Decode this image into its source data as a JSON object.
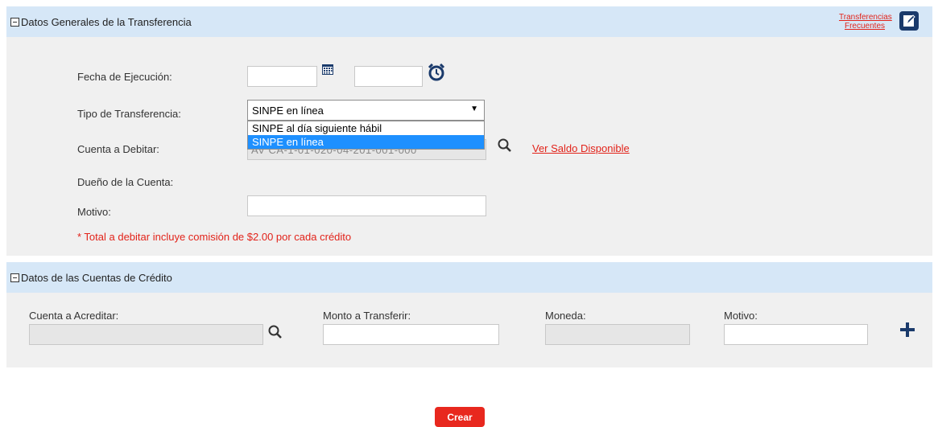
{
  "general": {
    "title": "Datos Generales de la Transferencia",
    "frequent_link_line1": "Transferencias",
    "frequent_link_line2": "Frecuentes",
    "fecha_label": "Fecha de Ejecución:",
    "fecha_value": "",
    "hora_value": "",
    "tipo_label": "Tipo de Transferencia:",
    "tipo_selected": "SINPE en línea",
    "tipo_options": [
      "SINPE al día siguiente hábil",
      "SINPE en línea"
    ],
    "cuenta_label": "Cuenta a Debitar:",
    "cuenta_value_partial": "AV CA-1-01-020-04-201-001-000",
    "ver_saldo_link": "Ver Saldo Disponible",
    "dueno_label": "Dueño de la Cuenta:",
    "motivo_label": "Motivo:",
    "motivo_value": "",
    "note": "* Total a debitar incluye comisión de $2.00 por cada crédito"
  },
  "credito": {
    "title": "Datos de las Cuentas de Crédito",
    "cuenta_label": "Cuenta a Acreditar:",
    "monto_label": "Monto a Transferir:",
    "moneda_label": "Moneda:",
    "motivo_label": "Motivo:"
  },
  "actions": {
    "crear_label": "Crear"
  },
  "colors": {
    "header_bg": "#d6e7f7",
    "section_bg": "#f0f0f0",
    "accent_red": "#e2231a",
    "icon_navy": "#1a3a6b",
    "selected_option": "#1e90ff"
  },
  "icons": [
    "calendar-icon",
    "alarm-clock-icon",
    "edit-icon",
    "search-icon",
    "plus-icon"
  ]
}
